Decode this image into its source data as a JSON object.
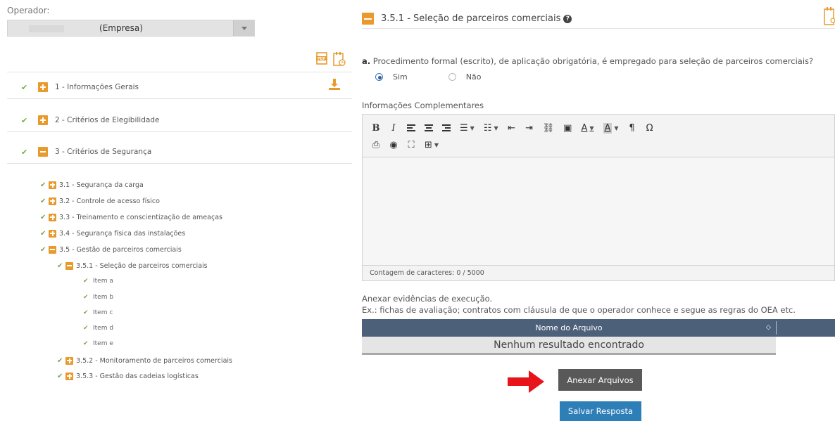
{
  "operator": {
    "label": "Operador:",
    "selected": "(Empresa)"
  },
  "sections": [
    {
      "label": "1 - Informações Gerais",
      "state": "collapsed"
    },
    {
      "label": "2 - Critérios de Elegibilidade",
      "state": "collapsed"
    },
    {
      "label": "3 - Critérios de Segurança",
      "state": "expanded"
    }
  ],
  "subsections": [
    {
      "label": "3.1 - Segurança da carga",
      "state": "collapsed"
    },
    {
      "label": "3.2 - Controle de acesso físico",
      "state": "collapsed"
    },
    {
      "label": "3.3 - Treinamento e conscientização de ameaças",
      "state": "collapsed"
    },
    {
      "label": "3.4 - Segurança física das instalações",
      "state": "collapsed"
    },
    {
      "label": "3.5 - Gestão de parceiros comerciais",
      "state": "expanded"
    },
    {
      "label": "3.5.1 - Seleção de parceiros comerciais",
      "state": "expanded"
    },
    {
      "label": "3.5.2 - Monitoramento de parceiros comerciais",
      "state": "collapsed"
    },
    {
      "label": "3.5.3 - Gestão das cadeias logísticas",
      "state": "collapsed"
    }
  ],
  "items": [
    "Item a",
    "Item b",
    "Item c",
    "Item d",
    "Item e"
  ],
  "panel": {
    "title": "3.5.1 - Seleção de parceiros comerciais",
    "question_prefix": "a.",
    "question": "Procedimento formal (escrito), de aplicação obrigatória, é empregado para seleção de parceiros comerciais?",
    "option_yes": "Sim",
    "option_no": "Não",
    "selected": "Sim",
    "info_label": "Informações Complementares",
    "char_count": "Contagem de caracteres: 0 / 5000",
    "attach_label": "Anexar evidências de execução.",
    "attach_hint": "Ex.: fichas de avaliação; contratos com cláusula de que o operador conhece e segue as regras do OEA etc.",
    "table_header": "Nome do Arquivo",
    "table_empty": "Nenhum resultado encontrado",
    "attach_button": "Anexar Arquivos",
    "save_button": "Salvar Resposta"
  },
  "toolbar": {
    "bold": "B",
    "italic": "I",
    "font_color": "A",
    "bg_color": "A",
    "paragraph": "¶",
    "omega": "Ω"
  },
  "colors": {
    "accent_orange": "#e89a2c",
    "check_green": "#7aa84a",
    "header_navy": "#4d607a",
    "save_blue": "#2e7fb8",
    "arrow_red": "#e8141c"
  }
}
